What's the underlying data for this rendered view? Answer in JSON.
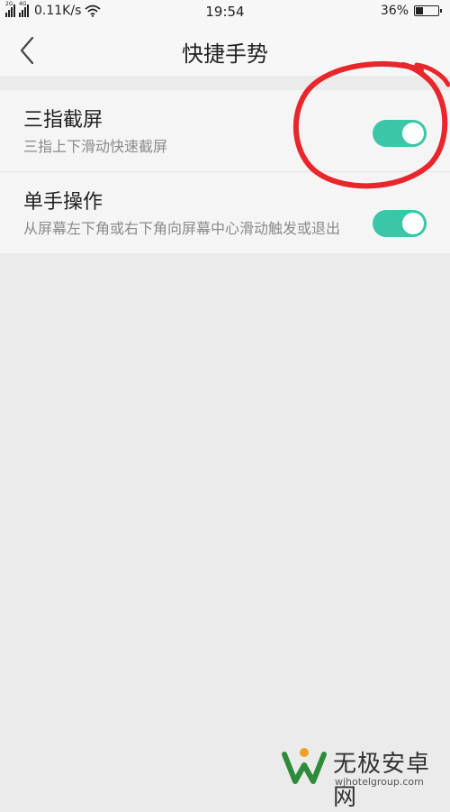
{
  "status_bar": {
    "sim1_tag": "2G",
    "sim2_tag": "4G",
    "speed": "0.11K/s",
    "time": "19:54",
    "battery_percent": "36%",
    "battery_level": 0.36
  },
  "header": {
    "title": "快捷手势"
  },
  "settings": [
    {
      "label": "三指截屏",
      "description": "三指上下滑动快速截屏",
      "enabled": true
    },
    {
      "label": "单手操作",
      "description": "从屏幕左下角或右下角向屏幕中心滑动触发或退出",
      "enabled": true
    }
  ],
  "colors": {
    "toggle_on": "#3cc6a8",
    "annotation_circle": "#e8262b"
  },
  "watermark": {
    "name": "无极安卓网",
    "url": "wjhotelgroup.com"
  }
}
